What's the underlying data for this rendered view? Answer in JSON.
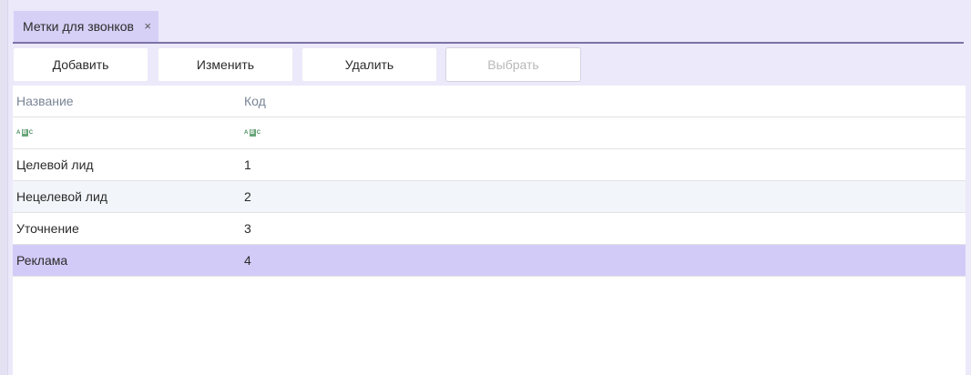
{
  "tab": {
    "title": "Метки для звонков",
    "close_glyph": "×"
  },
  "toolbar": {
    "add_label": "Добавить",
    "edit_label": "Изменить",
    "delete_label": "Удалить",
    "select_label": "Выбрать"
  },
  "grid": {
    "columns": [
      "Название",
      "Код"
    ],
    "filter_icon": "abc-filter-icon",
    "rows": [
      {
        "name": "Целевой лид",
        "code": "1"
      },
      {
        "name": "Нецелевой лид",
        "code": "2"
      },
      {
        "name": "Уточнение",
        "code": "3"
      },
      {
        "name": "Реклама",
        "code": "4"
      }
    ],
    "selected_row": 3
  },
  "colors": {
    "background": "#ece9fa",
    "tab_active": "#d6d0f6",
    "tab_underline": "#7c72a6",
    "row_alt": "#f2f5f9",
    "row_selected": "#d3cbf7",
    "header_text": "#7a8596"
  }
}
